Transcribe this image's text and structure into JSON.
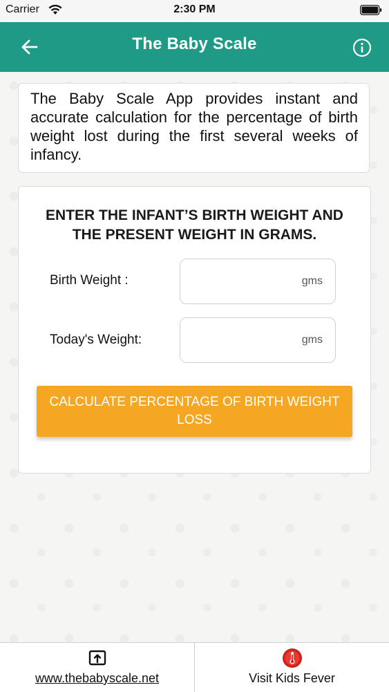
{
  "status_bar": {
    "carrier": "Carrier",
    "time": "2:30 PM"
  },
  "header": {
    "title": "The Baby Scale",
    "color": "#1f9a86"
  },
  "description": {
    "text": "The Baby Scale App provides instant and accurate calculation for the percentage of birth weight lost during the first several weeks of infancy."
  },
  "form": {
    "heading": "ENTER THE INFANT’S BIRTH WEIGHT AND THE PRESENT WEIGHT IN GRAMS.",
    "birth_weight": {
      "label": "Birth Weight :",
      "value": "",
      "placeholder": "gms"
    },
    "todays_weight": {
      "label": "Today's Weight:",
      "value": "",
      "placeholder": "gms"
    },
    "calculate_button": {
      "label": "CALCULATE PERCENTAGE OF BIRTH WEIGHT LOSS",
      "color": "#f5a623"
    }
  },
  "bottom_bar": {
    "items": [
      {
        "label": "www.thebabyscale.net",
        "icon": "open-external-icon"
      },
      {
        "label": "Visit Kids Fever",
        "icon": "thermometer-icon"
      }
    ]
  }
}
